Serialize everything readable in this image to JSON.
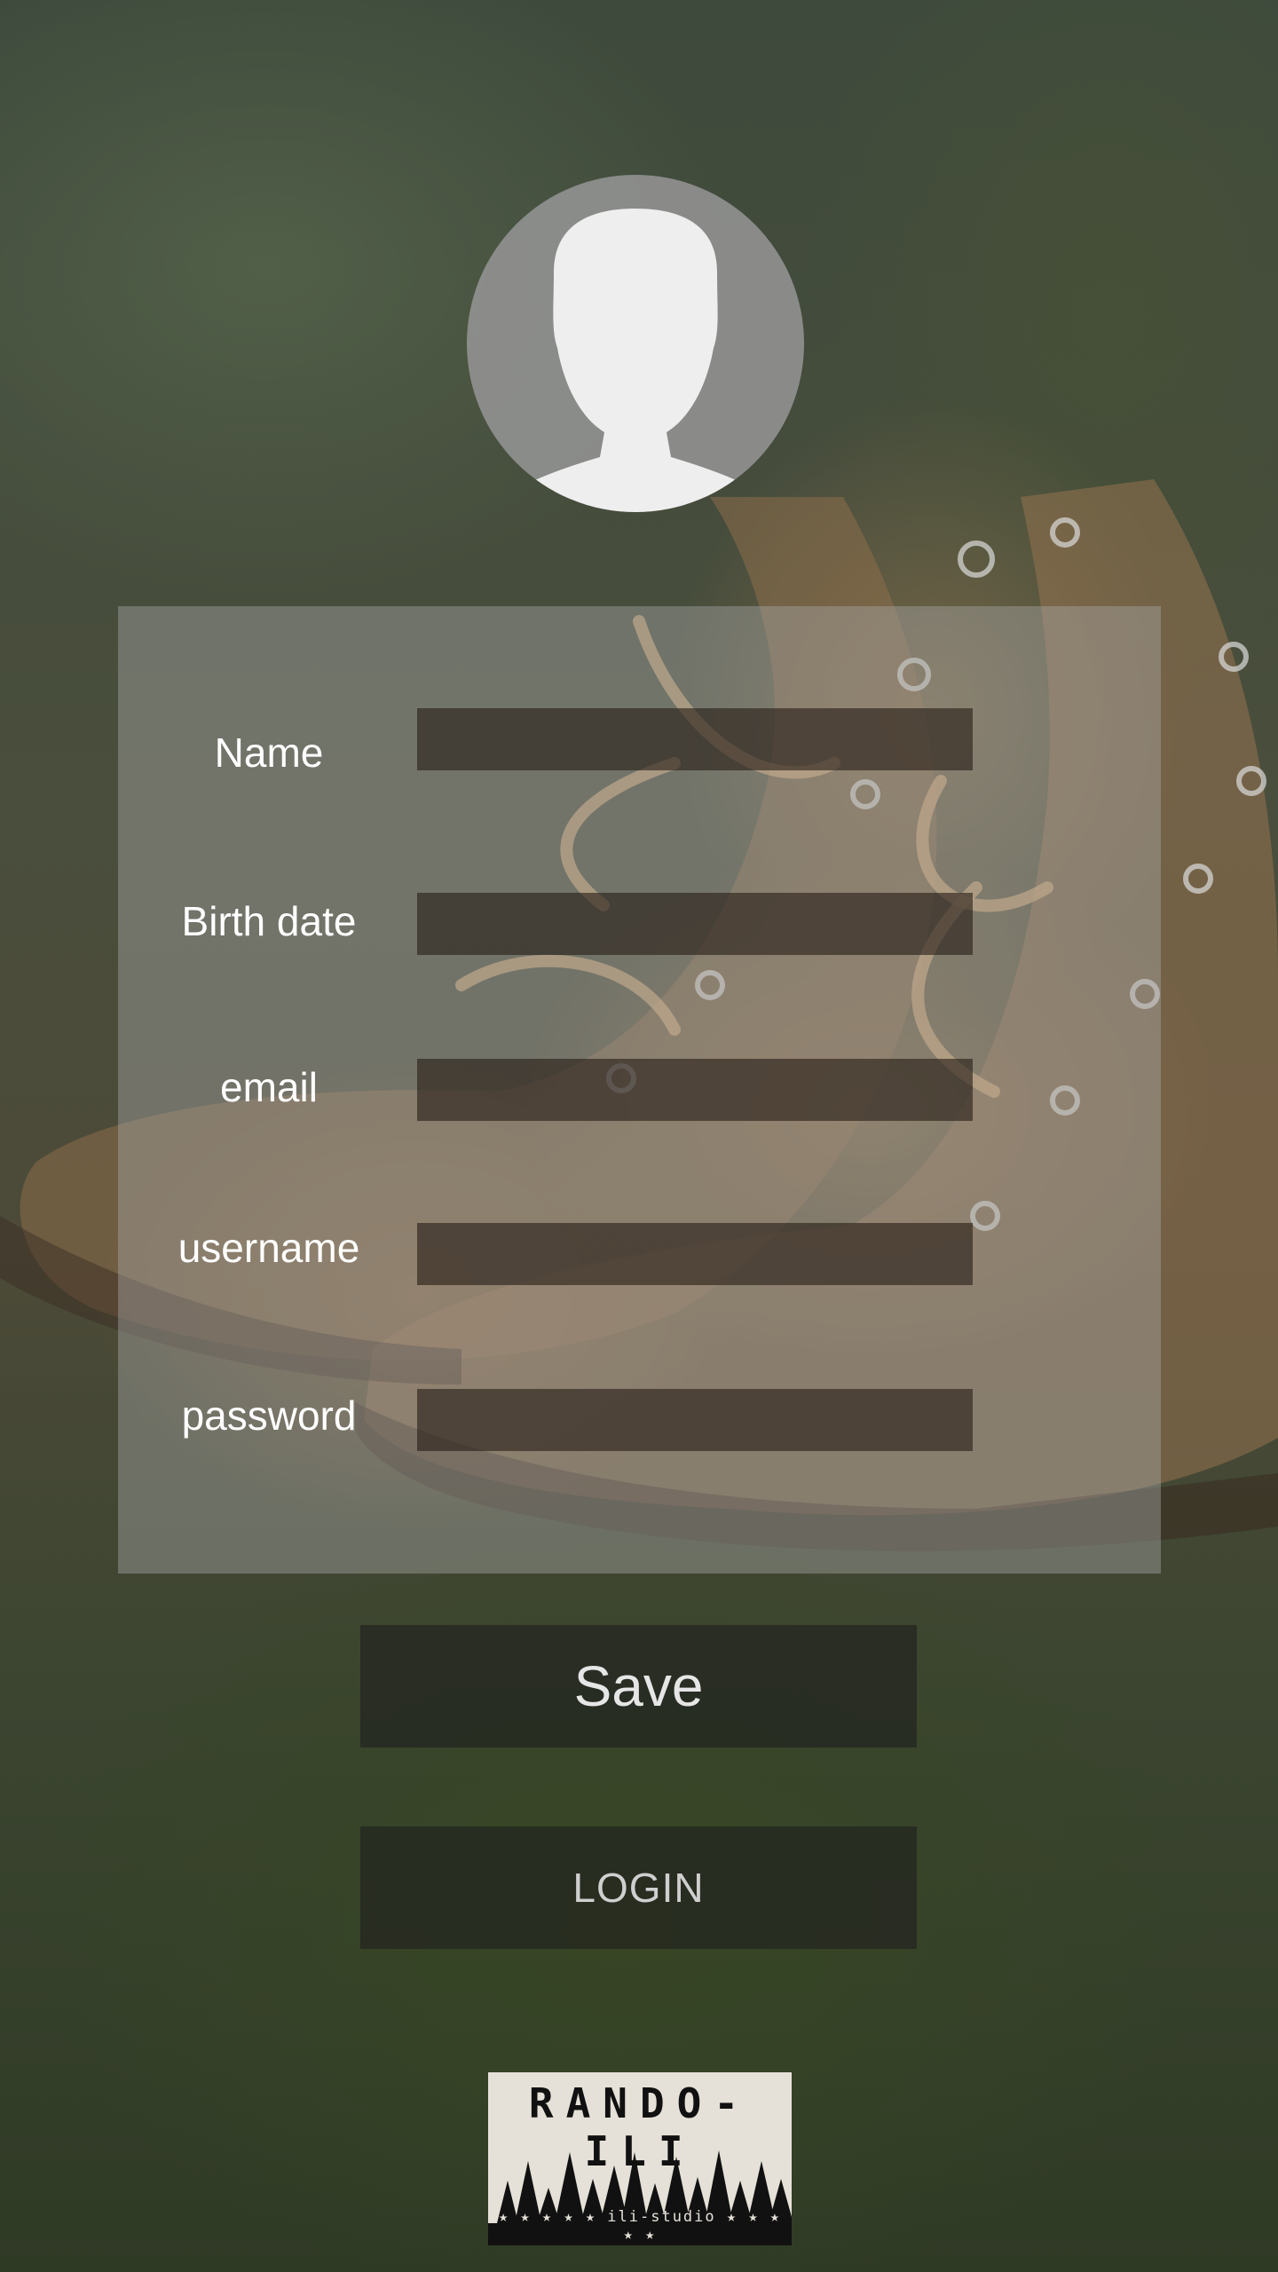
{
  "form": {
    "fields": [
      {
        "label": "Name",
        "value": ""
      },
      {
        "label": "Birth date",
        "value": ""
      },
      {
        "label": "email",
        "value": ""
      },
      {
        "label": "username",
        "value": ""
      },
      {
        "label": "password",
        "value": ""
      }
    ]
  },
  "actions": {
    "save_label": "Save",
    "login_label": "LOGIN"
  },
  "logo": {
    "title": "RANDO-ILI",
    "subtitle": "★ ★ ★ ★ ★  ili-studio  ★ ★ ★ ★ ★"
  },
  "icons": {
    "avatar": "user-silhouette-icon"
  },
  "colors": {
    "panel": "#aaaaaa",
    "input_bg": "#281e19",
    "button_bg": "#1e1e1e",
    "label_text": "#ffffff"
  }
}
